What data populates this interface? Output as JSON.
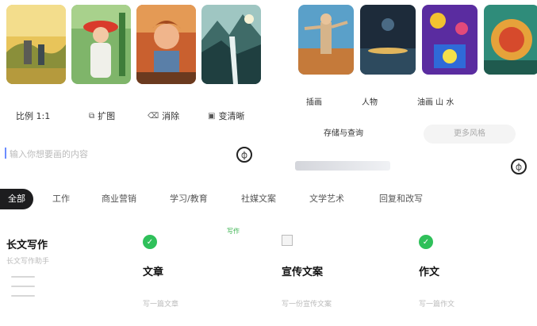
{
  "left_panel": {
    "thumbnails": [
      {
        "name": "thumb-painting-1",
        "caption": ""
      },
      {
        "name": "thumb-painting-2",
        "caption": ""
      },
      {
        "name": "thumb-painting-3",
        "caption": ""
      },
      {
        "name": "thumb-painting-4",
        "caption": ""
      }
    ],
    "tools": [
      {
        "label": "比例 1:1",
        "icon": ""
      },
      {
        "label": "扩图",
        "icon": "expand-icon"
      },
      {
        "label": "消除",
        "icon": "eraser-icon"
      },
      {
        "label": "变清晰",
        "icon": "sharpen-icon"
      }
    ],
    "input_placeholder": "输入你想要画的内容",
    "mic_glyph": "⏀"
  },
  "right_panel": {
    "thumbnails": [
      {
        "name": "thumb-art-1"
      },
      {
        "name": "thumb-art-2"
      },
      {
        "name": "thumb-art-3"
      },
      {
        "name": "thumb-art-4"
      }
    ],
    "labels": [
      "插画",
      "人物",
      "油画 山 水"
    ],
    "chips": [
      "存储与查询",
      "更多风格"
    ],
    "mic_glyph": "⏀"
  },
  "tabs": [
    "全部",
    "工作",
    "商业营销",
    "学习/教育",
    "社媒文案",
    "文学艺术",
    "回复和改写"
  ],
  "cards": {
    "longform": {
      "title": "长文写作",
      "desc": "长文写作助手"
    },
    "article": {
      "title": "文章",
      "desc": "写一篇文章",
      "badge": "写作",
      "icon": "check-icon"
    },
    "promo": {
      "title": "宣传文案",
      "desc": "写一份宣传文案"
    },
    "essay": {
      "title": "作文",
      "desc": "写一篇作文",
      "icon": "check-icon"
    }
  },
  "colors": {
    "active_tab_bg": "#1d1d1f",
    "accent_green": "#2fc05a"
  }
}
